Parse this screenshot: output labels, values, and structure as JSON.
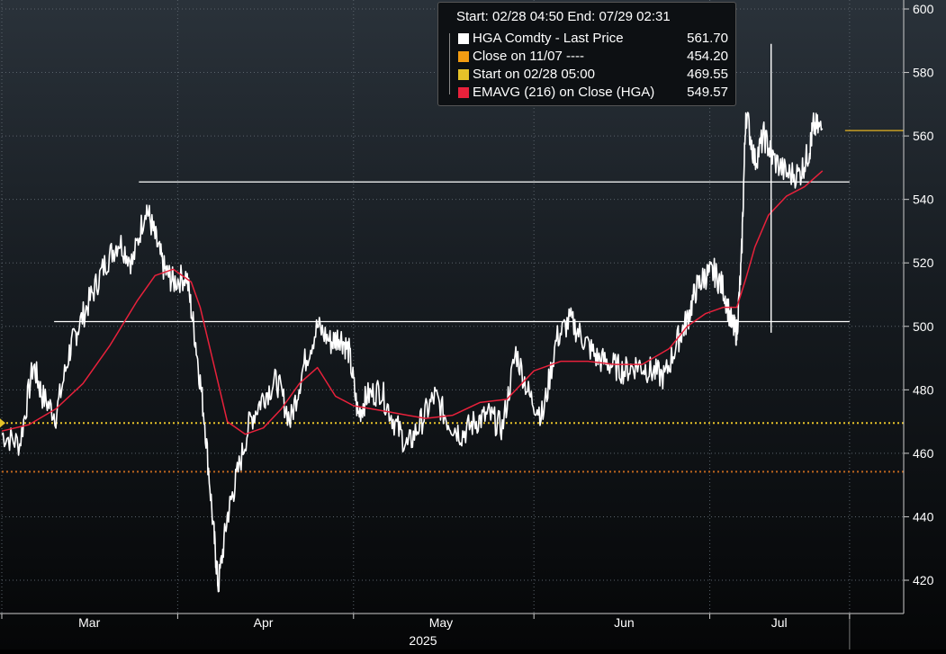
{
  "chart_data": {
    "type": "line",
    "xlim_months": [
      "Mar",
      "Apr",
      "May",
      "Jun",
      "Jul"
    ],
    "x_axis_year": "2025",
    "ylim": [
      410,
      600
    ],
    "y_ticks": [
      420,
      440,
      460,
      480,
      500,
      520,
      540,
      560,
      580,
      600
    ],
    "x_ticks": [
      "Mar",
      "Apr",
      "May",
      "Jun",
      "Jul"
    ],
    "legend": {
      "header": "Start: 02/28 04:50 End: 07/29 02:31",
      "placement": "top-center",
      "items": [
        {
          "label": "HGA Comdty - Last Price",
          "value": "561.70",
          "color": "#ffffff"
        },
        {
          "label": "Close on 11/07 ----",
          "value": "454.20",
          "color": "#f39c12"
        },
        {
          "label": "Start on 02/28 05:00",
          "value": "469.55",
          "color": "#e6c229"
        },
        {
          "label": "EMAVG (216)  on Close (HGA)",
          "value": "549.57",
          "color": "#e8213b"
        }
      ]
    },
    "reference_lines": [
      {
        "value": 469.55,
        "style": "dotted",
        "color": "#e6c229"
      },
      {
        "value": 454.2,
        "style": "dotted",
        "color": "#c0661e"
      },
      {
        "value": 561.7,
        "style": "solid",
        "color": "#e6b422",
        "span": "end"
      },
      {
        "value": 545.5,
        "style": "solid",
        "color": "#ffffff",
        "from_month_frac": 0.152
      },
      {
        "value": 501.5,
        "style": "solid",
        "color": "#ffffff",
        "from_month_frac": 0.058
      }
    ],
    "series": [
      {
        "name": "HGA Comdty - Last Price",
        "color": "#ffffff",
        "x": [
          0,
          0.02,
          0.035,
          0.045,
          0.06,
          0.075,
          0.085,
          0.1,
          0.115,
          0.13,
          0.145,
          0.16,
          0.17,
          0.18,
          0.19,
          0.205,
          0.215,
          0.225,
          0.235,
          0.24,
          0.25,
          0.26,
          0.275,
          0.29,
          0.305,
          0.32,
          0.335,
          0.35,
          0.365,
          0.375,
          0.385,
          0.395,
          0.405,
          0.42,
          0.435,
          0.45,
          0.465,
          0.48,
          0.495,
          0.51,
          0.525,
          0.54,
          0.555,
          0.57,
          0.585,
          0.6,
          0.615,
          0.63,
          0.645,
          0.66,
          0.675,
          0.69,
          0.705,
          0.72,
          0.735,
          0.75,
          0.76,
          0.77,
          0.78,
          0.79,
          0.8,
          0.81,
          0.815,
          0.82,
          0.825,
          0.835,
          0.845,
          0.855,
          0.87,
          0.885,
          0.895,
          0.9,
          0.91
        ],
        "y": [
          466,
          463,
          488,
          478,
          472,
          492,
          500,
          510,
          520,
          527,
          520,
          538,
          528,
          518,
          514,
          516,
          495,
          470,
          435,
          418,
          440,
          452,
          470,
          478,
          483,
          470,
          488,
          500,
          495,
          497,
          492,
          472,
          478,
          480,
          470,
          462,
          470,
          478,
          470,
          466,
          470,
          472,
          468,
          492,
          478,
          472,
          496,
          502,
          496,
          490,
          488,
          486,
          488,
          486,
          484,
          496,
          502,
          512,
          516,
          517,
          512,
          500,
          498,
          520,
          568,
          552,
          560,
          553,
          548,
          548,
          555,
          563,
          562
        ]
      },
      {
        "name": "EMAVG (216)  on Close (HGA)",
        "color": "#e8213b",
        "x": [
          0,
          0.03,
          0.06,
          0.09,
          0.12,
          0.15,
          0.17,
          0.19,
          0.21,
          0.22,
          0.235,
          0.25,
          0.27,
          0.29,
          0.31,
          0.33,
          0.35,
          0.37,
          0.39,
          0.41,
          0.43,
          0.45,
          0.47,
          0.5,
          0.53,
          0.56,
          0.59,
          0.62,
          0.65,
          0.68,
          0.71,
          0.74,
          0.76,
          0.78,
          0.8,
          0.815,
          0.825,
          0.835,
          0.85,
          0.87,
          0.89,
          0.91
        ],
        "y": [
          467,
          469,
          474,
          482,
          494,
          508,
          516,
          518,
          514,
          506,
          488,
          470,
          466,
          468,
          474,
          482,
          487,
          478,
          475,
          474,
          473,
          472,
          471,
          472,
          476,
          477,
          486,
          489,
          489,
          488,
          488,
          493,
          500,
          504,
          506,
          506,
          515,
          525,
          535,
          541,
          544,
          549
        ]
      }
    ]
  }
}
